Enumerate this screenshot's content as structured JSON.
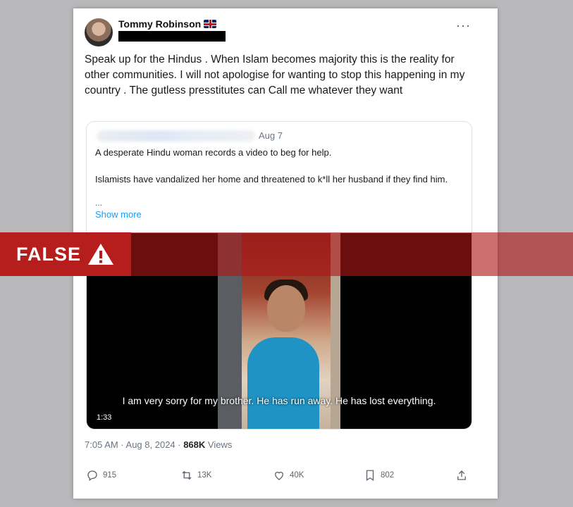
{
  "post": {
    "author_name": "Tommy Robinson",
    "text": "Speak up for the Hindus . When Islam becomes majority this is the reality for other communities. I will not apologise for wanting to stop this happening in my country . The gutless presstitutes can Call me whatever they want",
    "quoted": {
      "date": "Aug 7",
      "line1": "A desperate Hindu woman records a video to beg for help.",
      "line2": "Islamists have vandalized her home and threatened to k*ll her husband if they find him.",
      "ellipsis": "...",
      "show_more": "Show more",
      "video_subtitle": "I am very sorry for my brother. He has run away. He has lost everything.",
      "video_duration": "1:33"
    },
    "timestamp": "7:05 AM · Aug 8, 2024 · ",
    "views_count": "868K",
    "views_label": " Views",
    "actions": {
      "replies": "915",
      "reposts": "13K",
      "likes": "40K",
      "bookmarks": "802"
    }
  },
  "fact_check_label": "FALSE",
  "colors": {
    "banner_red": "#b51e1c",
    "link_blue": "#1d9bf0"
  }
}
